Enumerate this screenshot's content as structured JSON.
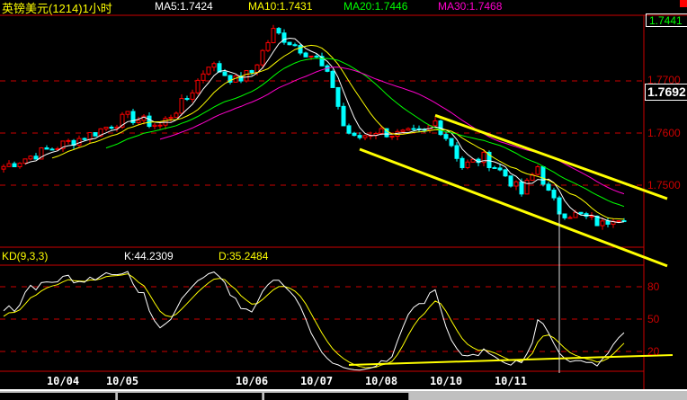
{
  "header": {
    "title": "英镑美元(1214)1小时",
    "ma5": "MA5:1.7424",
    "ma10": "MA10:1.7431",
    "ma20": "MA20:1.7446",
    "ma30": "MA30:1.7468"
  },
  "price_axis": {
    "last": "1.7441",
    "cursor": "1.7692",
    "ticks": [
      "1.7700",
      "1.7600",
      "1.7500"
    ]
  },
  "kd_header": {
    "label": "KD(9,3,3)",
    "k": "K:44.2309",
    "d": "D:35.2484"
  },
  "kd_axis": {
    "ticks": [
      "80",
      "50",
      "20"
    ]
  },
  "colors": {
    "up": "#ff0000",
    "down": "#00ffff",
    "ma5": "#ffffff",
    "ma10": "#ffff00",
    "ma20": "#00ff00",
    "ma30": "#ff00cc",
    "trend": "#ffff00",
    "grid": "#cc0000"
  },
  "chart_data": {
    "type": "candlestick",
    "title": "英镑美元(1214)1小时",
    "candle_count": 116,
    "ylim": [
      1.738,
      1.783
    ],
    "y_gridlines": [
      1.77,
      1.76,
      1.75
    ],
    "close_keypoints": [
      {
        "i": 0,
        "c": 1.7536
      },
      {
        "i": 9,
        "c": 1.7571
      },
      {
        "i": 16,
        "c": 1.7597
      },
      {
        "i": 23,
        "c": 1.7631
      },
      {
        "i": 29,
        "c": 1.7614
      },
      {
        "i": 34,
        "c": 1.7666
      },
      {
        "i": 38,
        "c": 1.7734
      },
      {
        "i": 43,
        "c": 1.77
      },
      {
        "i": 46,
        "c": 1.7717
      },
      {
        "i": 50,
        "c": 1.7795
      },
      {
        "i": 54,
        "c": 1.7769
      },
      {
        "i": 58,
        "c": 1.7743
      },
      {
        "i": 61,
        "c": 1.7691
      },
      {
        "i": 63,
        "c": 1.7614
      },
      {
        "i": 65,
        "c": 1.7588
      },
      {
        "i": 69,
        "c": 1.7605
      },
      {
        "i": 73,
        "c": 1.7597
      },
      {
        "i": 78,
        "c": 1.76
      },
      {
        "i": 80,
        "c": 1.7622
      },
      {
        "i": 83,
        "c": 1.7579
      },
      {
        "i": 85,
        "c": 1.7536
      },
      {
        "i": 89,
        "c": 1.7553
      },
      {
        "i": 93,
        "c": 1.7519
      },
      {
        "i": 96,
        "c": 1.7484
      },
      {
        "i": 99,
        "c": 1.7536
      },
      {
        "i": 101,
        "c": 1.7484
      },
      {
        "i": 103,
        "c": 1.745
      },
      {
        "i": 107,
        "c": 1.7441
      },
      {
        "i": 111,
        "c": 1.7424
      },
      {
        "i": 113,
        "c": 1.7441
      },
      {
        "i": 115,
        "c": 1.7441
      }
    ],
    "moving_averages": [
      {
        "name": "MA5",
        "value": 1.7424
      },
      {
        "name": "MA10",
        "value": 1.7431
      },
      {
        "name": "MA20",
        "value": 1.7446
      },
      {
        "name": "MA30",
        "value": 1.7468
      }
    ],
    "trendlines": [
      {
        "name": "channel-upper",
        "from": {
          "i": 80,
          "p": 1.7634
        },
        "to": {
          "i": 123,
          "p": 1.7474
        }
      },
      {
        "name": "channel-lower",
        "from": {
          "i": 66,
          "p": 1.7569
        },
        "to": {
          "i": 123,
          "p": 1.7345
        }
      }
    ],
    "kd": {
      "k_last": 44.2309,
      "d_last": 35.2484,
      "ylim": [
        0,
        100
      ],
      "gridlines": [
        80,
        50,
        20
      ],
      "support_line": {
        "from": {
          "i": 64,
          "v": 7.5
        },
        "to": {
          "i": 124,
          "v": 16.7
        }
      }
    },
    "x_labels": [
      {
        "i": 11,
        "label": "10/04"
      },
      {
        "i": 22,
        "label": "10/05"
      },
      {
        "i": 46,
        "label": "10/06"
      },
      {
        "i": 58,
        "label": "10/07"
      },
      {
        "i": 70,
        "label": "10/08"
      },
      {
        "i": 82,
        "label": "10/10"
      },
      {
        "i": 94,
        "label": "10/11"
      }
    ],
    "cursor_index": 103
  }
}
